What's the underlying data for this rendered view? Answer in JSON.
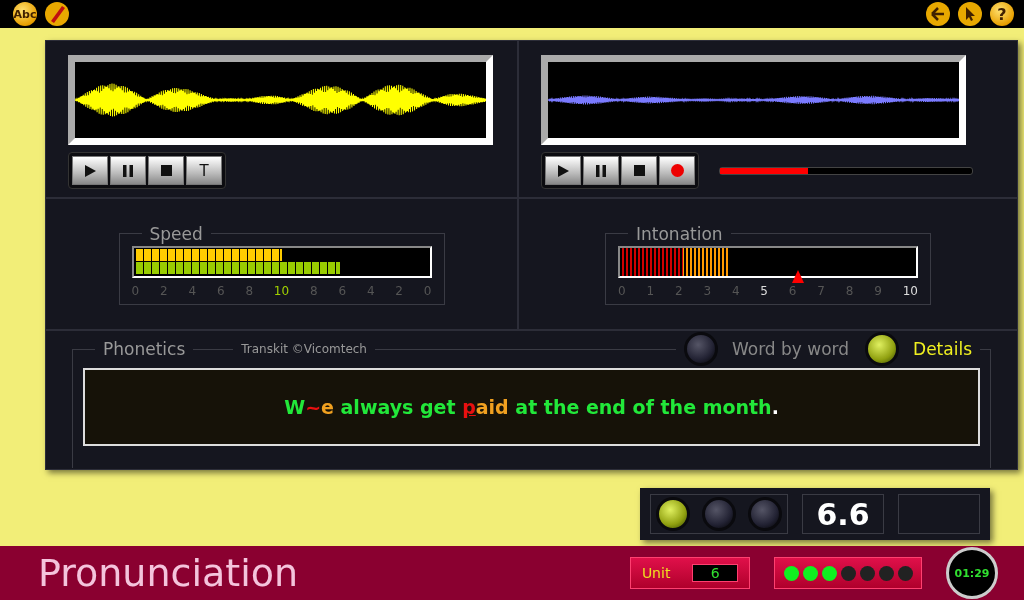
{
  "toolbar": {
    "abc_icon": "Abc",
    "help_icon": "?"
  },
  "players": [
    {
      "kind": "reference",
      "buttons": [
        {
          "kind": "play"
        },
        {
          "kind": "pause"
        },
        {
          "kind": "stop"
        },
        {
          "kind": "text",
          "label": "T"
        }
      ]
    },
    {
      "kind": "recording",
      "progress": {
        "level": 0.35
      },
      "buttons": [
        {
          "kind": "play"
        },
        {
          "kind": "pause"
        },
        {
          "kind": "stop"
        },
        {
          "kind": "record"
        }
      ]
    }
  ],
  "speed": {
    "title": "Speed",
    "top": {
      "level": 0.5
    },
    "bottom": {
      "level": 0.7
    },
    "ticks": [
      {
        "label": "0",
        "highlighted": false
      },
      {
        "label": "2",
        "highlighted": false
      },
      {
        "label": "4",
        "highlighted": false
      },
      {
        "label": "6",
        "highlighted": false
      },
      {
        "label": "8",
        "highlighted": false
      },
      {
        "label": "10",
        "highlighted": true
      },
      {
        "label": "8",
        "highlighted": false
      },
      {
        "label": "6",
        "highlighted": false
      },
      {
        "label": "4",
        "highlighted": false
      },
      {
        "label": "2",
        "highlighted": false
      },
      {
        "label": "0",
        "highlighted": false
      }
    ]
  },
  "intonation": {
    "title": "Intonation",
    "red": {
      "level": 0.21
    },
    "orange": {
      "level": 0.37
    },
    "marker": {
      "level": 0.6
    },
    "ticks": [
      {
        "label": "0",
        "highlighted": false
      },
      {
        "label": "1",
        "highlighted": false
      },
      {
        "label": "2",
        "highlighted": false
      },
      {
        "label": "3",
        "highlighted": false
      },
      {
        "label": "4",
        "highlighted": false
      },
      {
        "label": "5",
        "highlighted": true
      },
      {
        "label": "6",
        "highlighted": false
      },
      {
        "label": "7",
        "highlighted": false
      },
      {
        "label": "8",
        "highlighted": false
      },
      {
        "label": "9",
        "highlighted": false
      },
      {
        "label": "10",
        "highlighted": true
      }
    ]
  },
  "phonetics": {
    "title": "Phonetics",
    "credit": "Transkit ©Vicomtech",
    "modes": [
      {
        "label": "Word by word",
        "selected": false
      },
      {
        "label": "Details",
        "selected": true
      }
    ],
    "sentence": [
      {
        "text": "W",
        "color": "#22e83a",
        "underlined": false
      },
      {
        "text": "~",
        "color": "#e81010",
        "underlined": false
      },
      {
        "text": "e",
        "color": "#f0a020",
        "underlined": false
      },
      {
        "text": " always get ",
        "color": "#22e83a",
        "underlined": false
      },
      {
        "text": "p",
        "color": "#e81010",
        "underlined": true
      },
      {
        "text": "aid",
        "color": "#f0a020",
        "underlined": false
      },
      {
        "text": " at the end of the month",
        "color": "#22e83a",
        "underlined": false
      },
      {
        "text": ".",
        "color": "#ffffff",
        "underlined": false
      }
    ]
  },
  "score": {
    "lights": [
      {
        "on": true
      },
      {
        "on": false
      },
      {
        "on": false
      }
    ],
    "value": "6.6"
  },
  "footer": {
    "title": "Pronunciation",
    "unit_label": "Unit",
    "unit_value": "6",
    "dots": [
      {
        "on": true
      },
      {
        "on": true
      },
      {
        "on": true
      },
      {
        "on": false
      },
      {
        "on": false
      },
      {
        "on": false
      },
      {
        "on": false
      }
    ],
    "timer": "01:29"
  }
}
